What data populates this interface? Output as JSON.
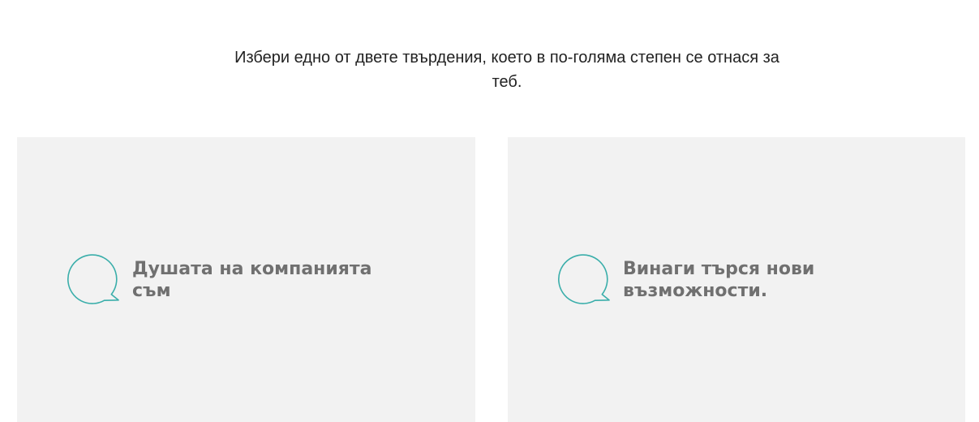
{
  "prompt": {
    "line1": "Избери едно от двете твърдения, което в по-голяма степен се отнася за",
    "line2": "теб."
  },
  "options": [
    {
      "icon": "speech-bubble-icon",
      "lines": [
        "Душата на компанията съм"
      ]
    },
    {
      "icon": "speech-bubble-icon",
      "lines": [
        "Винаги търся нови",
        "възможности."
      ]
    }
  ],
  "colors": {
    "accent": "#3aaeaa",
    "card_background": "#f2f2f2",
    "option_text": "#707070",
    "prompt_text": "#222222"
  }
}
